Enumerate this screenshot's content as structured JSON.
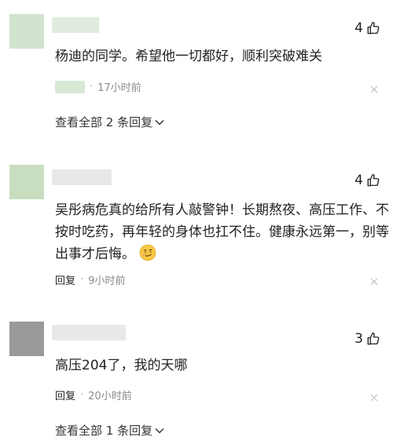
{
  "comments": [
    {
      "avatar_color": "#d2e3d0",
      "name_color": "#e0ece0",
      "likes": "4",
      "text": "杨迪的同学。希望他一切都好，顺利突破难关",
      "time": "17小时前",
      "more": "查看全部 2 条回复"
    },
    {
      "avatar_color": "#c9ddbf",
      "name_color": "#e7e9e7",
      "likes": "4",
      "text": "吴彤病危真的给所有人敲警钟！长期熬夜、高压工作、不按时吃药，再年轻的身体也扛不住。健康永远第一，别等出事才后悔。",
      "reply_label": "回复",
      "time": "9小时前"
    },
    {
      "avatar_color": "#9a9a9a",
      "name_color": "#e8e8e8",
      "likes": "3",
      "text": "高压204了，我的天哪",
      "reply_label": "回复",
      "time": "20小时前",
      "more": "查看全部 1 条回复"
    }
  ],
  "icons": {
    "like": "thumbs-up-icon",
    "close": "close-icon",
    "expand": "chevron-down-icon",
    "emoji": "smirk-emoji"
  }
}
